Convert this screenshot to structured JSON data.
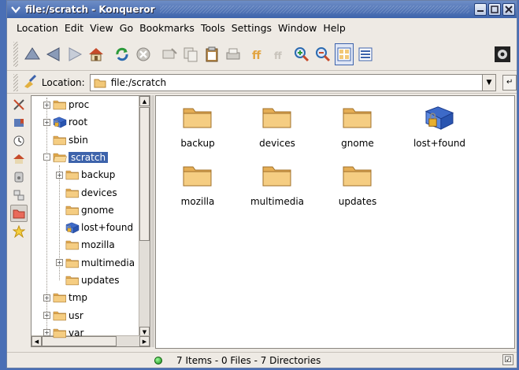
{
  "window": {
    "title": "file:/scratch - Konqueror"
  },
  "menu": [
    "Location",
    "Edit",
    "View",
    "Go",
    "Bookmarks",
    "Tools",
    "Settings",
    "Window",
    "Help"
  ],
  "toolbar": {
    "icons": [
      "up-arrow-icon",
      "back-arrow-icon",
      "forward-arrow-icon",
      "home-icon",
      "reload-icon",
      "stop-icon",
      "cut-icon",
      "copy-icon",
      "paste-icon",
      "print-icon",
      "zoom-font-icon",
      "shrink-font-icon",
      "zoom-in-icon",
      "zoom-out-icon",
      "icon-view-icon",
      "detail-view-icon",
      "konqueror-gear-icon"
    ]
  },
  "location": {
    "label": "Location:",
    "value": "file:/scratch"
  },
  "tree": [
    {
      "label": "proc",
      "indent": 0,
      "expander": "+",
      "icon": "folder"
    },
    {
      "label": "root",
      "indent": 0,
      "expander": "+",
      "icon": "folder-locked"
    },
    {
      "label": "sbin",
      "indent": 0,
      "expander": "",
      "icon": "folder"
    },
    {
      "label": "scratch",
      "indent": 0,
      "expander": "-",
      "icon": "folder-open",
      "selected": true
    },
    {
      "label": "backup",
      "indent": 1,
      "expander": "+",
      "icon": "folder"
    },
    {
      "label": "devices",
      "indent": 1,
      "expander": "",
      "icon": "folder"
    },
    {
      "label": "gnome",
      "indent": 1,
      "expander": "",
      "icon": "folder"
    },
    {
      "label": "lost+found",
      "indent": 1,
      "expander": "",
      "icon": "folder-locked"
    },
    {
      "label": "mozilla",
      "indent": 1,
      "expander": "",
      "icon": "folder"
    },
    {
      "label": "multimedia",
      "indent": 1,
      "expander": "+",
      "icon": "folder"
    },
    {
      "label": "updates",
      "indent": 1,
      "expander": "",
      "icon": "folder"
    },
    {
      "label": "tmp",
      "indent": 0,
      "expander": "+",
      "icon": "folder"
    },
    {
      "label": "usr",
      "indent": 0,
      "expander": "+",
      "icon": "folder"
    },
    {
      "label": "var",
      "indent": 0,
      "expander": "+",
      "icon": "folder"
    }
  ],
  "items": [
    {
      "label": "backup",
      "icon": "folder"
    },
    {
      "label": "devices",
      "icon": "folder"
    },
    {
      "label": "gnome",
      "icon": "folder"
    },
    {
      "label": "lost+found",
      "icon": "folder-locked"
    },
    {
      "label": "mozilla",
      "icon": "folder"
    },
    {
      "label": "multimedia",
      "icon": "folder"
    },
    {
      "label": "updates",
      "icon": "folder"
    }
  ],
  "status": {
    "text": "7 Items - 0 Files - 7 Directories"
  },
  "colors": {
    "titlebar": "#3d63ab",
    "selection": "#3d63ab",
    "folder": "#f2c878"
  }
}
